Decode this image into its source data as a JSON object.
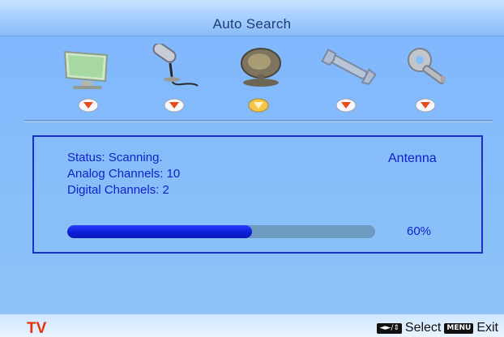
{
  "menu": {
    "title": "Auto Search",
    "icons": [
      {
        "name": "picture-monitor-icon",
        "selected": false
      },
      {
        "name": "audio-microphone-icon",
        "selected": false
      },
      {
        "name": "tv-satellite-dish-icon",
        "selected": true
      },
      {
        "name": "setup-wrench-icon",
        "selected": false
      },
      {
        "name": "parental-key-icon",
        "selected": false
      }
    ],
    "colors": {
      "marker": "#e84a1a",
      "marker_selected": "#f5c64a",
      "accent": "#0d22c8"
    }
  },
  "status": {
    "line1": "Status: Scanning.",
    "line2": "Analog Channels: 10",
    "line3": "Digital Channels: 2",
    "source": "Antenna"
  },
  "progress": {
    "fraction": 0.6,
    "label": "60%"
  },
  "footer": {
    "input": "TV",
    "navigate_keys": "◄►/⇕",
    "select_label": "Select",
    "menu_key": "MENU",
    "exit_label": "Exit"
  }
}
